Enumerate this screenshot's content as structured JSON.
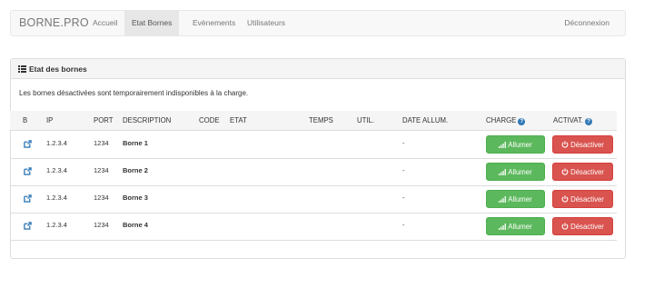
{
  "navbar": {
    "brand": "BORNE.PRO",
    "items": [
      {
        "label": "Accueil",
        "active": false
      },
      {
        "label": "Etat Bornes",
        "active": true
      },
      {
        "label": "Evènements",
        "active": false
      },
      {
        "label": "Utilisateurs",
        "active": false
      }
    ],
    "logout": "Déconnexion"
  },
  "panel": {
    "title": "Etat des bornes",
    "title_icon": "list-icon",
    "intro": "Les bornes désactivées sont temporairement indisponibles à la charge."
  },
  "table": {
    "headers": [
      "B",
      "IP",
      "PORT",
      "DESCRIPTION",
      "CODE",
      "ETAT",
      "TEMPS",
      "UTIL.",
      "DATE ALLUM.",
      "CHARGE",
      "ACTIVAT."
    ],
    "rows": [
      {
        "ip": "1.2.3.4",
        "port": "1234",
        "description": "Borne 1",
        "code": "",
        "etat": "",
        "temps": "",
        "util": "",
        "date": "-",
        "on_label": "Allumer",
        "off_label": "Désactiver"
      },
      {
        "ip": "1.2.3.4",
        "port": "1234",
        "description": "Borne 2",
        "code": "",
        "etat": "",
        "temps": "",
        "util": "",
        "date": "-",
        "on_label": "Allumer",
        "off_label": "Désactiver"
      },
      {
        "ip": "1.2.3.4",
        "port": "1234",
        "description": "Borne 3",
        "code": "",
        "etat": "",
        "temps": "",
        "util": "",
        "date": "-",
        "on_label": "Allumer",
        "off_label": "Désactiver"
      },
      {
        "ip": "1.2.3.4",
        "port": "1234",
        "description": "Borne 4",
        "code": "",
        "etat": "",
        "temps": "",
        "util": "",
        "date": "-",
        "on_label": "Allumer",
        "off_label": "Désactiver"
      }
    ]
  },
  "colors": {
    "success": "#5cb85c",
    "danger": "#d9534f",
    "primary": "#337ab7"
  }
}
